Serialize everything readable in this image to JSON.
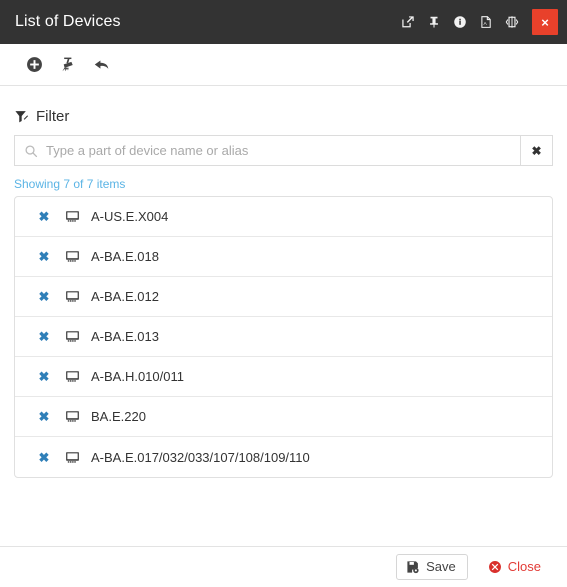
{
  "window": {
    "title": "List of Devices",
    "title_actions": [
      {
        "name": "popout-icon",
        "label": "Open in new window"
      },
      {
        "name": "pin-icon",
        "label": "Pin"
      },
      {
        "name": "info-icon",
        "label": "Info"
      },
      {
        "name": "pdf-icon",
        "label": "Export PDF"
      },
      {
        "name": "flip-icon",
        "label": "Flip panel"
      }
    ],
    "close_label": "×"
  },
  "toolbar": {
    "buttons": [
      {
        "name": "add-icon",
        "label": "Add"
      },
      {
        "name": "broom-icon",
        "label": "Clear all"
      },
      {
        "name": "undo-icon",
        "label": "Undo"
      }
    ]
  },
  "filter": {
    "label": "Filter",
    "placeholder": "Type a part of device name or alias",
    "value": "",
    "clear_label": "✖"
  },
  "list": {
    "showing_text": "Showing 7 of 7 items",
    "remove_label": "✖",
    "rows": [
      {
        "name": "A-US.E.X004"
      },
      {
        "name": "A-BA.E.018"
      },
      {
        "name": "A-BA.E.012"
      },
      {
        "name": "A-BA.E.013"
      },
      {
        "name": "A-BA.H.010/011"
      },
      {
        "name": "BA.E.220"
      },
      {
        "name": "A-BA.E.017/032/033/107/108/109/110"
      }
    ]
  },
  "footer": {
    "save_label": "Save",
    "close_label": "Close"
  },
  "colors": {
    "titlebar_bg": "#333333",
    "close_red": "#e8412b",
    "link_blue": "#5bb4e5",
    "row_remove_blue": "#2f7fb8",
    "close_text_red": "#e23b36"
  }
}
